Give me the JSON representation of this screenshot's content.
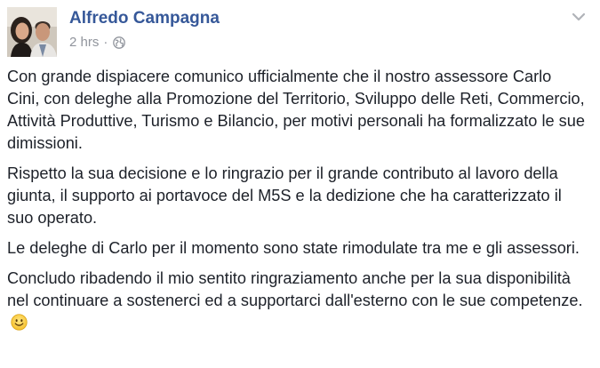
{
  "post": {
    "author": "Alfredo Campagna",
    "time": "2 hrs",
    "separator": "·",
    "privacy_icon": "globe-icon",
    "menu_icon": "chevron-down-icon",
    "paragraphs": [
      "Con grande dispiacere comunico ufficialmente che il nostro assessore Carlo Cini, con deleghe alla Promozione del Territorio, Sviluppo delle Reti, Commercio, Attività Produttive, Turismo e Bilancio, per motivi personali ha formalizzato le sue dimissioni.",
      "Rispetto la sua decisione e lo ringrazio per il grande contributo al lavoro della giunta, il supporto ai portavoce del M5S e la dedizione che ha caratterizzato il suo operato.",
      "Le deleghe di Carlo per il momento sono state rimodulate tra me e gli assessori.",
      "Concludo ribadendo il mio sentito ringraziamento anche per la sua disponibilità nel continuare a sostenerci ed a supportarci dall'esterno con le sue competenze."
    ],
    "emoji": "smiley-emoji",
    "colors": {
      "author": "#365899",
      "meta": "#90949c",
      "text": "#1d2129"
    }
  }
}
